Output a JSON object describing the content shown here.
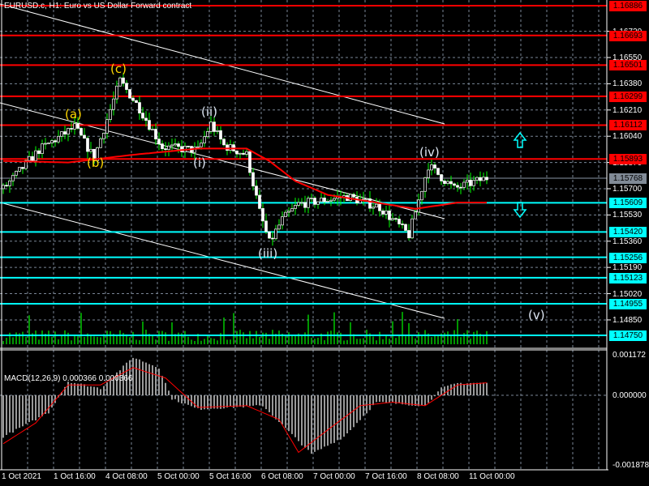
{
  "header": {
    "title": "EURUSD.c, H1:  Euro vs US Dollar Forward contract"
  },
  "price_axis": {
    "ticks": [
      "1.16720",
      "1.16550",
      "1.16380",
      "1.16210",
      "1.16040",
      "1.15870",
      "1.15700",
      "1.15530",
      "1.15360",
      "1.15190",
      "1.15020",
      "1.14850"
    ],
    "current_price": "1.15768",
    "resistance_levels": [
      "1.16886",
      "1.16693",
      "1.16501",
      "1.16299",
      "1.16112",
      "1.15893"
    ],
    "support_levels": [
      "1.15609",
      "1.15420",
      "1.15256",
      "1.15123",
      "1.14955",
      "1.14750"
    ]
  },
  "colors": {
    "resistance": "#ff0000",
    "support": "#00ffff",
    "candle_wick": "#00ff00",
    "ma": "#ff0000",
    "macd_hist": "#c0c0c0",
    "macd_signal": "#ff0000",
    "current": "#808a96"
  },
  "waves": {
    "a": "(a)",
    "b": "(b)",
    "c": "(c)",
    "i": "(i)",
    "ii": "(ii)",
    "iii": "(iii)",
    "iv": "(iv)",
    "v": "(v)"
  },
  "macd": {
    "title": "MACD(12,26,9) 0.000366 0.000366",
    "max_label": "0.001172",
    "zero_label": "0.000000",
    "min_label": "-0.001878"
  },
  "time_axis": [
    "1 Oct 2021",
    "1 Oct 16:00",
    "4 Oct 08:00",
    "5 Oct 00:00",
    "5 Oct 16:00",
    "6 Oct 08:00",
    "7 Oct 00:00",
    "7 Oct 16:00",
    "8 Oct 08:00",
    "11 Oct 00:00"
  ],
  "price_path": [
    [
      0,
      1.157
    ],
    [
      11,
      1.1595
    ],
    [
      22,
      1.161
    ],
    [
      28,
      1.159
    ],
    [
      36,
      1.164
    ],
    [
      42,
      1.1622
    ],
    [
      49,
      1.1597
    ],
    [
      60,
      1.1595
    ],
    [
      64,
      1.1612
    ],
    [
      68,
      1.1598
    ],
    [
      75,
      1.1592
    ],
    [
      79,
      1.1555
    ],
    [
      82,
      1.1535
    ],
    [
      86,
      1.155
    ],
    [
      91,
      1.156
    ],
    [
      106,
      1.1565
    ],
    [
      116,
      1.1558
    ],
    [
      125,
      1.154
    ],
    [
      129,
      1.157
    ],
    [
      131,
      1.1585
    ],
    [
      139,
      1.157
    ],
    [
      149,
      1.1577
    ]
  ],
  "ma_path": [
    [
      0,
      1.1588
    ],
    [
      20,
      1.1587
    ],
    [
      40,
      1.1592
    ],
    [
      60,
      1.1596
    ],
    [
      75,
      1.1596
    ],
    [
      82,
      1.1588
    ],
    [
      90,
      1.1575
    ],
    [
      100,
      1.1566
    ],
    [
      115,
      1.1561
    ],
    [
      127,
      1.1557
    ],
    [
      140,
      1.1561
    ],
    [
      149,
      1.1561
    ]
  ],
  "macd_hist_path": [
    [
      0,
      -0.0012
    ],
    [
      14,
      -0.0005
    ],
    [
      20,
      0.0004
    ],
    [
      30,
      0.0002
    ],
    [
      40,
      0.0011
    ],
    [
      48,
      0.0008
    ],
    [
      52,
      -0.0001
    ],
    [
      60,
      -0.0004
    ],
    [
      80,
      -0.0003
    ],
    [
      95,
      -0.0017
    ],
    [
      105,
      -0.0012
    ],
    [
      115,
      -0.0002
    ],
    [
      130,
      -0.0003
    ],
    [
      135,
      0.0002
    ],
    [
      140,
      0.00035
    ],
    [
      149,
      0.00036
    ]
  ],
  "macd_signal_path": [
    [
      0,
      -0.0014
    ],
    [
      10,
      -0.0008
    ],
    [
      20,
      0.0003
    ],
    [
      30,
      0.0003
    ],
    [
      40,
      0.0008
    ],
    [
      50,
      0.0005
    ],
    [
      60,
      -0.00035
    ],
    [
      75,
      -0.0003
    ],
    [
      85,
      -0.0007
    ],
    [
      91,
      -0.00165
    ],
    [
      100,
      -0.001
    ],
    [
      110,
      -0.0003
    ],
    [
      120,
      -0.0002
    ],
    [
      130,
      -0.0003
    ],
    [
      140,
      0.0003
    ],
    [
      149,
      0.00036
    ]
  ]
}
